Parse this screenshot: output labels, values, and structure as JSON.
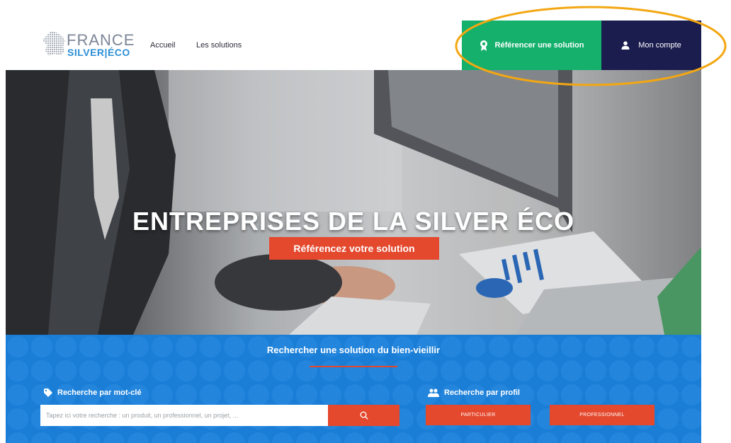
{
  "header": {
    "logo": {
      "line1": "FRANCE",
      "line2": "SILVER|ÉCO"
    },
    "nav": [
      {
        "label": "Accueil"
      },
      {
        "label": "Les solutions"
      }
    ],
    "referencer_label": "Référencer une solution",
    "compte_label": "Mon compte"
  },
  "hero": {
    "title": "ENTREPRISES DE LA SILVER ÉCO",
    "cta_label": "Référencez votre solution"
  },
  "search": {
    "title": "Rechercher une solution du bien-vieillir",
    "keyword_label": "Recherche par mot-clé",
    "input_placeholder": "Tapez ici votre recherche : un produit, un professionnel, un projet, ...",
    "profile_label": "Recherche par profil",
    "profiles": [
      {
        "label": "PARTICULIER"
      },
      {
        "label": "PROFESSIONNEL"
      }
    ]
  },
  "colors": {
    "green": "#15b06c",
    "navy": "#1b1d4f",
    "blue": "#1b7ed6",
    "orange_red": "#e4482d",
    "annotation": "#f3a712"
  },
  "icons": {
    "referencer": "award-badge-icon",
    "compte": "user-icon",
    "search": "search-icon",
    "keyword": "tag-icon",
    "profile": "users-icon"
  }
}
